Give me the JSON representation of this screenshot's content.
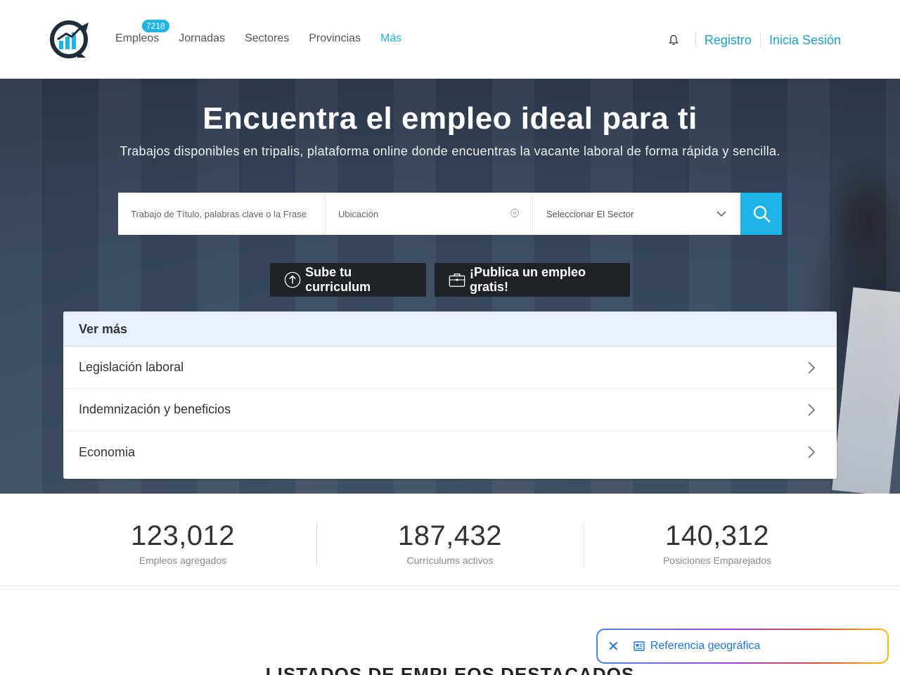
{
  "header": {
    "nav": [
      {
        "label": "Empleos",
        "badge": "7218"
      },
      {
        "label": "Jornadas"
      },
      {
        "label": "Sectores"
      },
      {
        "label": "Provincias"
      },
      {
        "label": "Más"
      }
    ],
    "register": "Registro",
    "login": "Inicia Sesión"
  },
  "hero": {
    "title": "Encuentra el empleo ideal para ti",
    "subtitle": "Trabajos disponibles en tripalis, plataforma online donde encuentras la vacante laboral de forma rápida y sencilla.",
    "search": {
      "keywords_placeholder": "Trabajo de Título, palabras clave o la Frase",
      "location_placeholder": "Ubicación",
      "sector_selected": "Seleccionar El Sector"
    },
    "upload_cv": "Sube tu curriculum",
    "publish_job": "¡Publica un empleo gratis!"
  },
  "ver_mas": {
    "title": "Ver más",
    "items": [
      "Legislación laboral",
      "Indemnización y beneficios",
      "Economia"
    ]
  },
  "stats": [
    {
      "value": "123,012",
      "label": "Empleos agregados"
    },
    {
      "value": "187,432",
      "label": "Currículums activos"
    },
    {
      "value": "140,312",
      "label": "Posiciones Emparejados"
    }
  ],
  "listados_title": "LISTADOS DE EMPLEOS DESTACADOS",
  "geo_chip": {
    "label": "Referencia geográfica"
  },
  "colors": {
    "accent": "#1eb4e6",
    "link": "#1e9fd2",
    "dark_button": "#1f2328"
  }
}
